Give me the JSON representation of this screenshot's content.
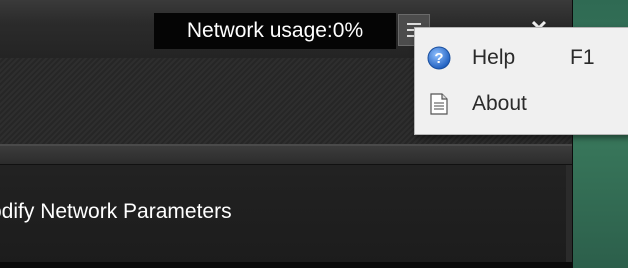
{
  "titlebar": {
    "network_usage": "Network usage:0%",
    "menu_button": "menu-icon",
    "minimize_button": "minimize-icon",
    "close_button": "close-icon"
  },
  "panel": {
    "title": "odify Network Parameters"
  },
  "menu": {
    "items": [
      {
        "label": "Help",
        "shortcut": "F1",
        "icon": "help-icon"
      },
      {
        "label": "About",
        "shortcut": "",
        "icon": "document-icon"
      }
    ]
  },
  "colors": {
    "titlebar": "#2b2b2b",
    "menu_background": "#f0f0f0",
    "help_icon": "#3a7bd5",
    "desktop": "#2f6a53"
  }
}
